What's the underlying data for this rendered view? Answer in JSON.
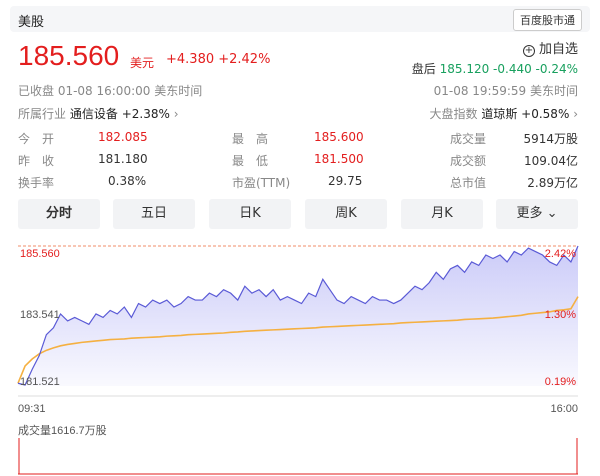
{
  "header": {
    "market_tab": "美股",
    "source": "百度股市通"
  },
  "quote": {
    "price": "185.560",
    "unit": "美元",
    "change": "+4.380 +2.42%",
    "add_watch": "加自选",
    "after_hours_label": "盘后",
    "after_hours_value": "185.120 -0.440 -0.24%",
    "status": "已收盘   01-08 16:00:00   美东时间",
    "after_hours_time": "01-08 19:59:59   美东时间",
    "industry_label": "所属行业",
    "industry_name": "通信设备",
    "industry_change": "+2.38%",
    "market_label": "大盘指数",
    "market_name": "道琼斯",
    "market_change": "+0.58%"
  },
  "stats": [
    [
      {
        "label": "今　开",
        "value": "182.085"
      },
      {
        "label": "最　高",
        "value": "185.600"
      },
      {
        "label": "成交量",
        "value": "5914万股"
      }
    ],
    [
      {
        "label": "昨　收",
        "value": "181.180"
      },
      {
        "label": "最　低",
        "value": "181.500"
      },
      {
        "label": "成交额",
        "value": "109.04亿"
      }
    ],
    [
      {
        "label": "换手率",
        "value": "0.38%"
      },
      {
        "label": "市盈(TTM)",
        "value": "29.75"
      },
      {
        "label": "总市值",
        "value": "2.89万亿"
      }
    ]
  ],
  "tabs": [
    "分时",
    "五日",
    "日K",
    "周K",
    "月K",
    "更多"
  ],
  "chart_data": {
    "type": "line",
    "y_labels_left": [
      "185.560",
      "183.541",
      "181.521"
    ],
    "y_labels_right": [
      "2.42%",
      "1.30%",
      "0.19%"
    ],
    "x_labels": [
      "09:31",
      "16:00"
    ],
    "volume_label": "成交量1616.7万股",
    "ylim": [
      181.521,
      185.56
    ],
    "reference_price": 183.541,
    "series": [
      {
        "values": [
          181.6,
          181.55,
          182.0,
          182.4,
          183.0,
          183.2,
          183.6,
          183.4,
          183.5,
          183.4,
          183.3,
          183.6,
          183.5,
          183.7,
          183.6,
          183.8,
          183.5,
          183.9,
          183.8,
          184.0,
          183.9,
          184.0,
          183.8,
          183.9,
          184.1,
          184.0,
          184.0,
          184.2,
          184.1,
          184.3,
          184.2,
          184.0,
          184.4,
          184.2,
          184.3,
          184.1,
          184.3,
          184.0,
          184.1,
          184.0,
          183.9,
          184.2,
          184.1,
          184.6,
          184.3,
          184.0,
          183.9,
          184.1,
          184.0,
          183.9,
          184.1,
          184.0,
          184.0,
          183.9,
          184.0,
          184.2,
          184.4,
          184.3,
          184.5,
          184.8,
          184.6,
          184.9,
          185.0,
          184.8,
          185.1,
          185.0,
          185.3,
          185.2,
          185.3,
          185.1,
          185.4,
          185.3,
          185.5,
          185.4,
          185.3,
          185.1,
          185.0,
          185.3,
          185.1,
          185.56
        ]
      },
      {
        "values": [
          181.6,
          182.1,
          182.3,
          182.45,
          182.55,
          182.62,
          182.68,
          182.72,
          182.75,
          182.78,
          182.8,
          182.82,
          182.84,
          182.86,
          182.87,
          182.88,
          182.9,
          182.91,
          182.92,
          182.93,
          182.94,
          182.96,
          182.97,
          182.98,
          183.0,
          183.01,
          183.02,
          183.03,
          183.04,
          183.05,
          183.07,
          183.08,
          183.1,
          183.11,
          183.12,
          183.13,
          183.14,
          183.15,
          183.16,
          183.17,
          183.18,
          183.19,
          183.2,
          183.22,
          183.23,
          183.24,
          183.25,
          183.26,
          183.27,
          183.28,
          183.29,
          183.3,
          183.31,
          183.32,
          183.34,
          183.35,
          183.36,
          183.37,
          183.38,
          183.39,
          183.4,
          183.41,
          183.42,
          183.44,
          183.45,
          183.46,
          183.47,
          183.48,
          183.5,
          183.52,
          183.54,
          183.56,
          183.6,
          183.62,
          183.64,
          183.66,
          183.7,
          183.72,
          183.75,
          184.1
        ]
      }
    ]
  }
}
